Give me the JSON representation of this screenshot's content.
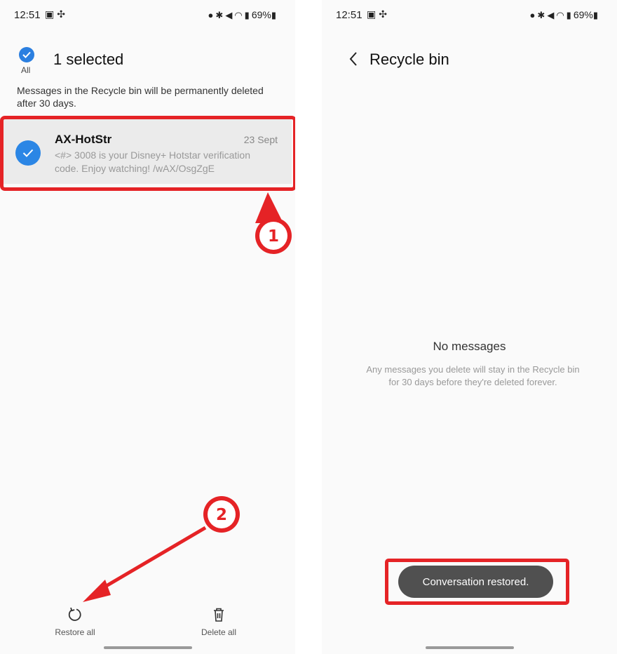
{
  "status_bar": {
    "time": "12:51",
    "battery": "69%",
    "left_icons": [
      "image-icon",
      "pinwheel-icon"
    ],
    "right_icons": [
      "lightbulb-icon",
      "bluetooth-icon",
      "mute-icon",
      "wifi-icon",
      "volte-icon",
      "signal-icon",
      "battery-icon"
    ]
  },
  "left_screen": {
    "select_all_label": "All",
    "selection_title": "1 selected",
    "notice": "Messages in the Recycle bin will be permanently deleted after 30 days.",
    "message": {
      "sender": "AX-HotStr",
      "date": "23 Sept",
      "preview": "<#> 3008 is your Disney+ Hotstar verification code. Enjoy watching! /wAX/OsgZgE"
    },
    "actions": [
      {
        "label": "Restore all",
        "icon": "restore-icon"
      },
      {
        "label": "Delete all",
        "icon": "trash-icon"
      }
    ]
  },
  "right_screen": {
    "title": "Recycle bin",
    "empty_title": "No messages",
    "empty_description": "Any messages you delete will stay in the Recycle bin for 30 days before they're deleted forever.",
    "toast": "Conversation restored."
  },
  "annotations": {
    "step1": "1",
    "step2": "2",
    "color": "#e52326"
  },
  "colors": {
    "accent": "#2b86e5",
    "highlight": "#e52326"
  }
}
